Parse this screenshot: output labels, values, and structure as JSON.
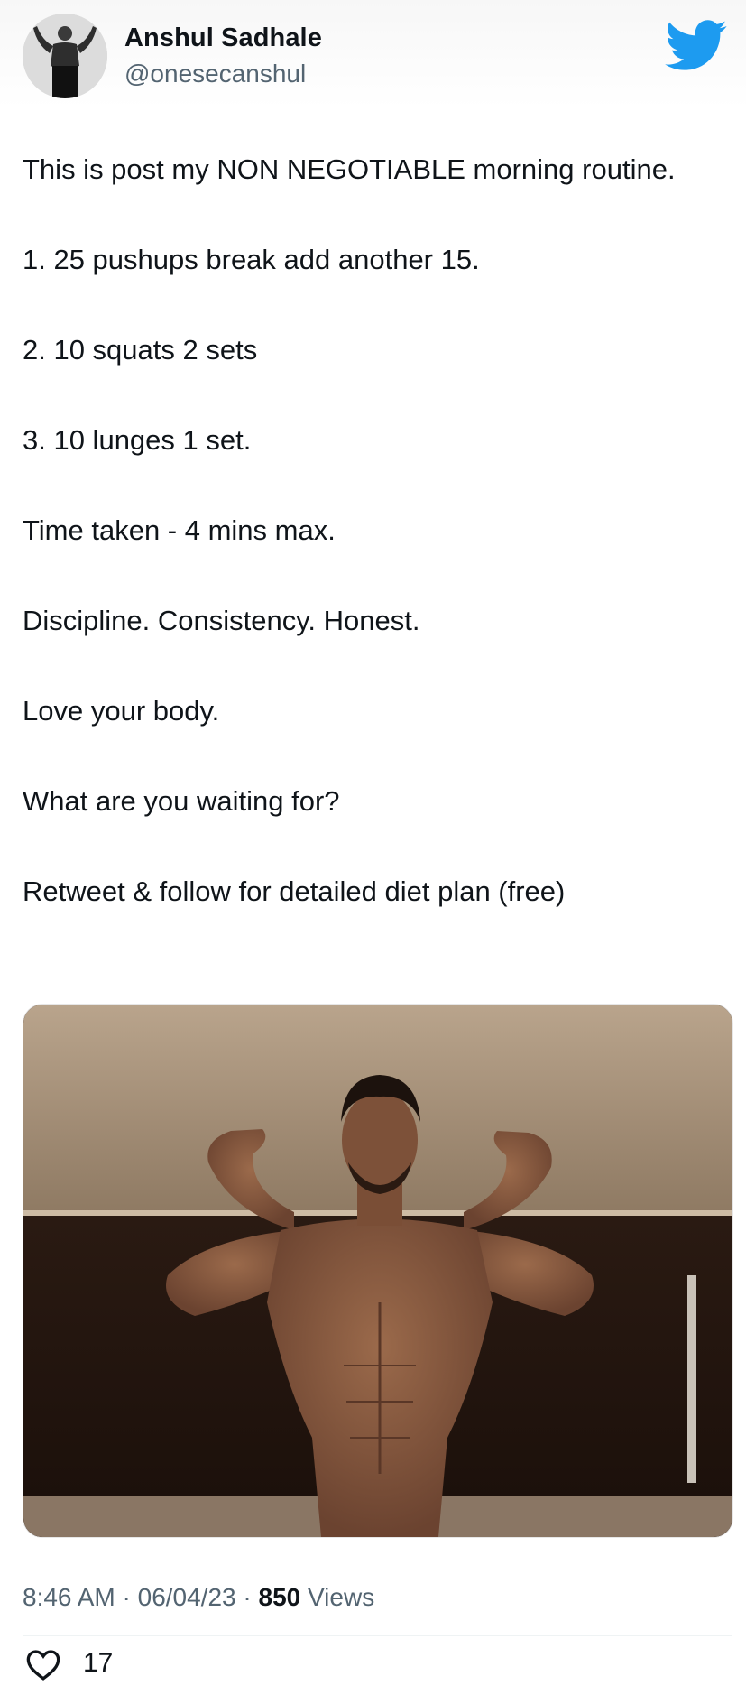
{
  "author": {
    "name": "Anshul Sadhale",
    "handle": "@onesecanshul"
  },
  "icons": {
    "brand": "twitter-bird-icon",
    "like": "heart-outline-icon"
  },
  "colors": {
    "brand": "#1d9bf0",
    "text": "#0f1419",
    "secondary_text": "#536471"
  },
  "tweet": {
    "lines": [
      "This is post my NON NEGOTIABLE morning routine.",
      "1. 25 pushups break add another 15.",
      "2. 10 squats 2 sets",
      "3. 10 lunges 1 set.",
      "Time taken - 4 mins max.",
      "Discipline. Consistency. Honest.",
      "Love your body.",
      "What are you waiting for?",
      "Retweet & follow for detailed diet plan (free)"
    ]
  },
  "meta": {
    "time": "8:46 AM",
    "separator": "·",
    "date": "06/04/23",
    "views_count": "850",
    "views_label": "Views"
  },
  "engagement": {
    "likes": "17"
  }
}
